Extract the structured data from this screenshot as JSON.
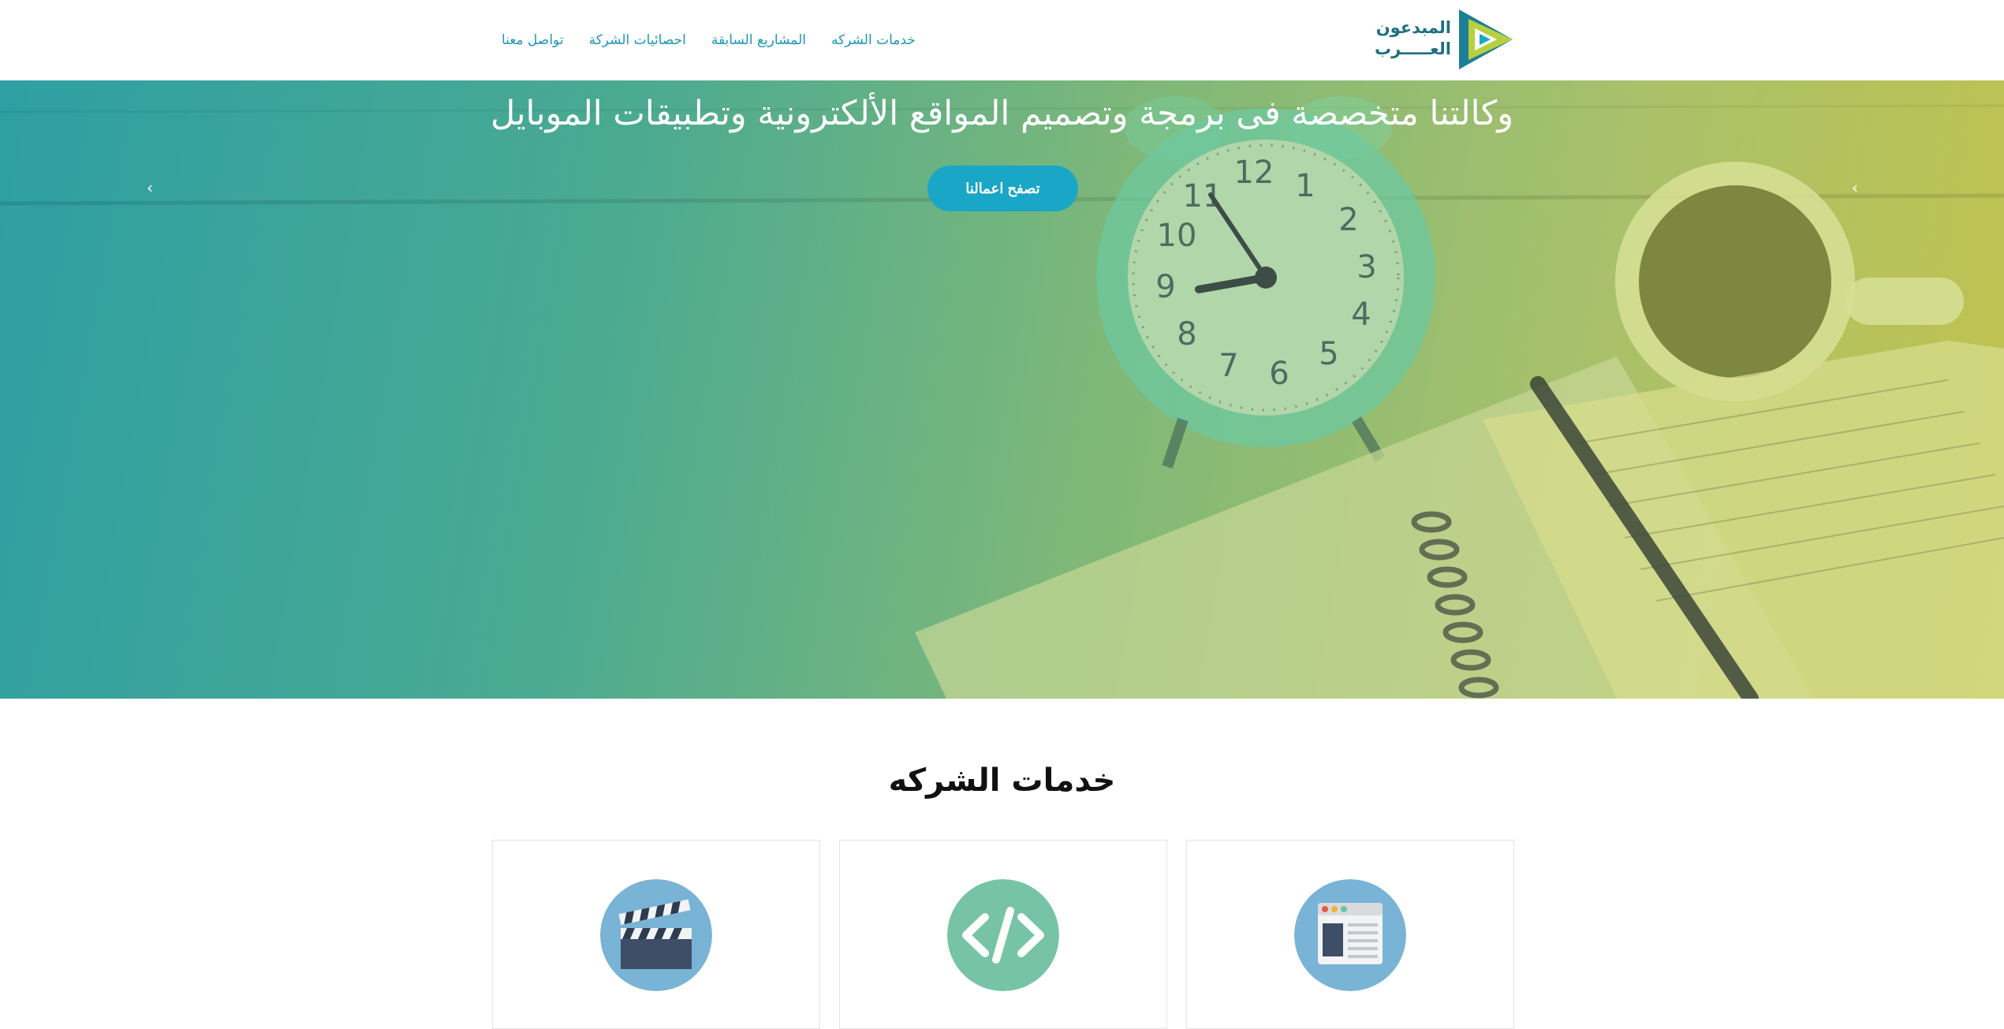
{
  "brand": {
    "line1": "المبدعون",
    "line2": "العـــــرب"
  },
  "nav": {
    "items": [
      {
        "label": "خدمات الشركه"
      },
      {
        "label": "المشاريع السابقة"
      },
      {
        "label": "احصائيات الشركة"
      },
      {
        "label": "تواصل معنا"
      }
    ]
  },
  "hero": {
    "title": "وكالتنا متخصصة فى برمجة وتصميم المواقع الألكترونية وتطبيقات الموبايل",
    "button_label": "تصفح اعمالنا",
    "prev_arrow": "‹",
    "next_arrow": "‹"
  },
  "services": {
    "title": "خدمات الشركه",
    "cards": [
      {
        "icon": "web-page-icon"
      },
      {
        "icon": "code-icon"
      },
      {
        "icon": "film-clapper-icon"
      }
    ]
  },
  "colors": {
    "accent": "#1aa6c6",
    "nav_link": "#1b98b5",
    "logo": "#1f6f80",
    "icon_blue": "#79b3d6",
    "icon_green": "#77c3a8"
  }
}
